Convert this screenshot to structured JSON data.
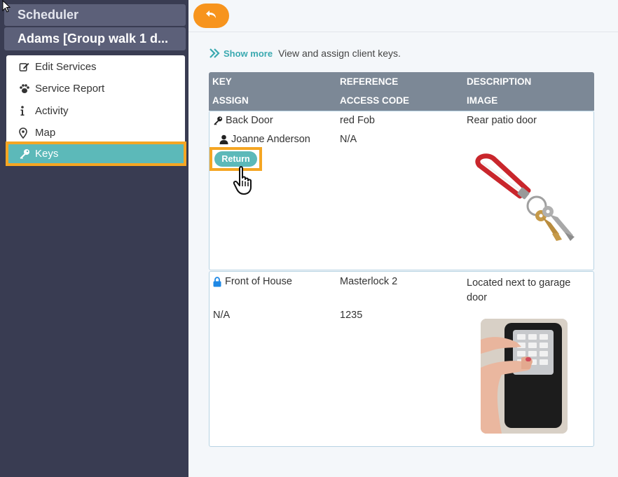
{
  "sidebar": {
    "title": "Scheduler",
    "subtitle": "Adams [Group walk 1 d...",
    "items": [
      {
        "label": "Edit Services",
        "icon": "edit-icon"
      },
      {
        "label": "Service Report",
        "icon": "paw-icon"
      },
      {
        "label": "Activity",
        "icon": "info-icon"
      },
      {
        "label": "Map",
        "icon": "map-pin-icon"
      },
      {
        "label": "Keys",
        "icon": "key-icon"
      }
    ]
  },
  "toolbar": {
    "back_icon": "undo-icon"
  },
  "intro": {
    "show_more": "Show more",
    "text": "View and assign client keys."
  },
  "table": {
    "headers": {
      "key": "KEY",
      "reference": "REFERENCE",
      "description": "DESCRIPTION",
      "assign": "ASSIGN",
      "access_code": "ACCESS CODE",
      "image": "IMAGE"
    },
    "rows": [
      {
        "key": "Back Door",
        "key_icon": "key-icon",
        "reference": "red Fob",
        "description": "Rear patio door",
        "assign": "Joanne Anderson",
        "assign_icon": "user-icon",
        "access_code": "N/A",
        "action": "Return",
        "image": "keys-image"
      },
      {
        "key": "Front of House",
        "key_icon": "lock-icon",
        "reference": "Masterlock 2",
        "description": "Located next to garage door",
        "assign": "N/A",
        "access_code": "1235",
        "image": "lockbox-image"
      }
    ]
  },
  "colors": {
    "sidebar_bg": "#393c52",
    "accent_teal": "#5cb9b9",
    "accent_orange": "#f7941d",
    "highlight": "#f5a623"
  }
}
